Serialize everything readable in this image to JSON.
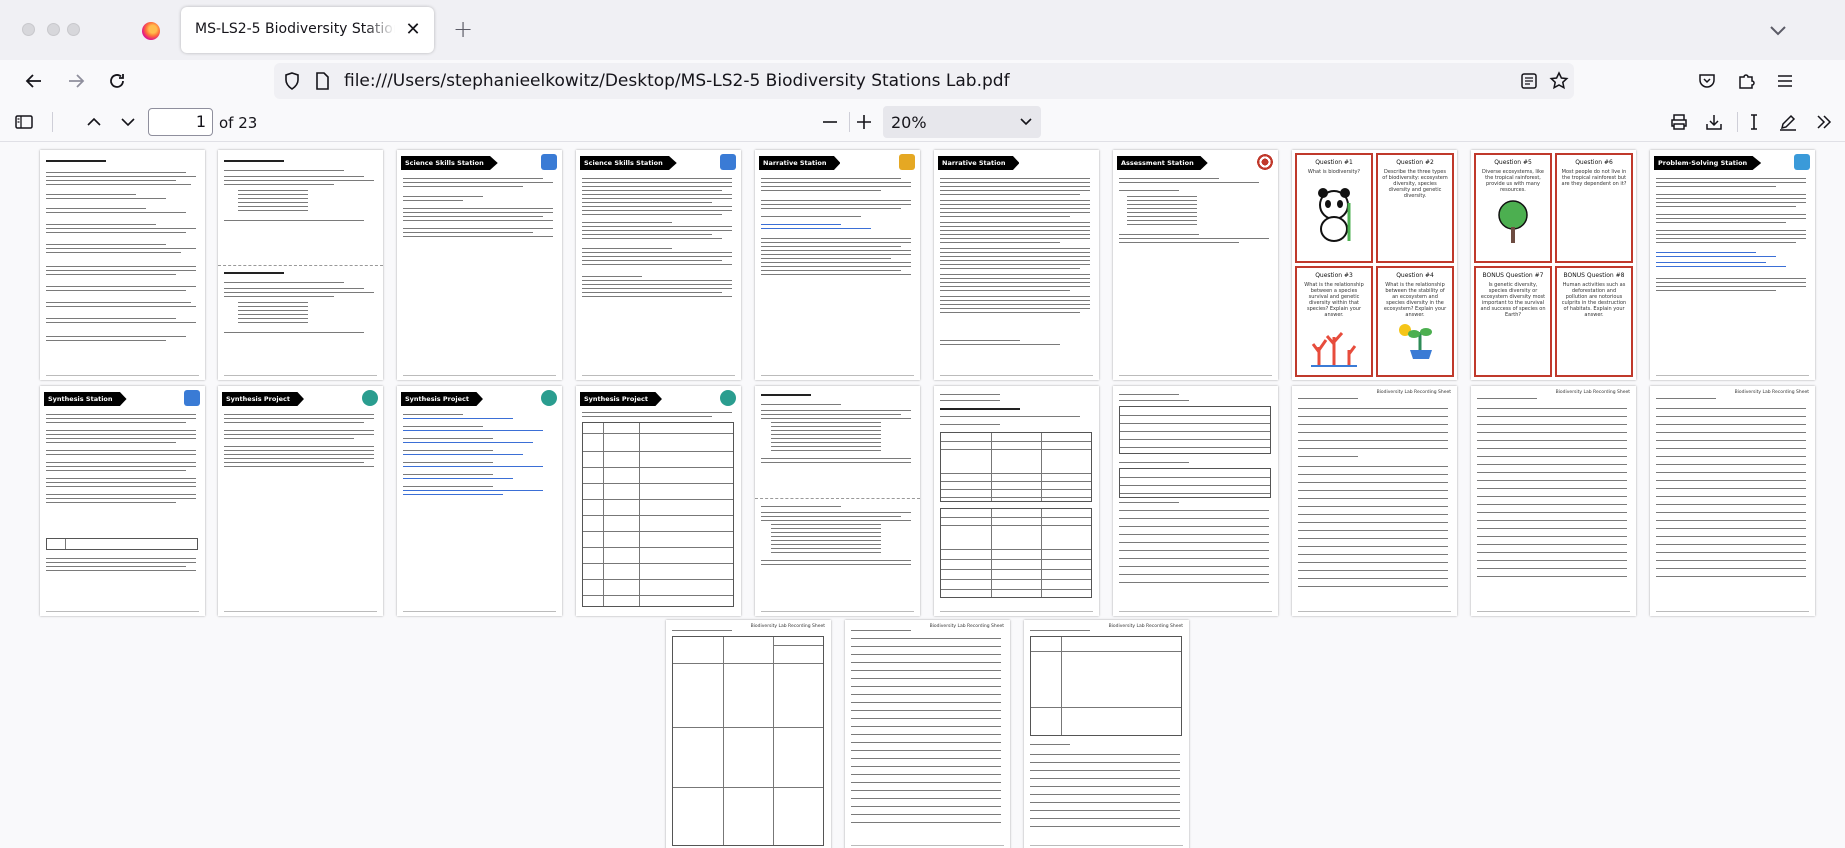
{
  "browser": {
    "tab_title": "MS-LS2-5 Biodiversity Stations Lab.pdf",
    "url": "file:///Users/stephanieelkowitz/Desktop/MS-LS2-5 Biodiversity Stations Lab.pdf"
  },
  "pdf_toolbar": {
    "page_number": "1",
    "page_total": "of 23",
    "zoom": "20%"
  },
  "thumbs": {
    "science_skills": "Science Skills Station",
    "narrative": "Narrative Station",
    "assessment": "Assessment Station",
    "problem_solving": "Problem-Solving Station",
    "synthesis_station": "Synthesis Station",
    "synthesis_project": "Synthesis Project",
    "recording_sheet": "Biodiversity Lab Recording Sheet"
  },
  "cards": [
    {
      "title": "Question #1",
      "body": "What is biodiversity?"
    },
    {
      "title": "Question #2",
      "body": "Describe the three types of biodiversity: ecosystem diversity, species diversity and genetic diversity."
    },
    {
      "title": "Question #5",
      "body": "Diverse ecosystems, like the tropical rainforest, provide us with many resources."
    },
    {
      "title": "Question #6",
      "body": "Most people do not live in the tropical rainforest but are they dependent on it?"
    },
    {
      "title": "Question #3",
      "body": "What is the relationship between a species survival and genetic diversity within that species? Explain your answer."
    },
    {
      "title": "Question #4",
      "body": "What is the relationship between the stability of an ecosystem and species diversity in the ecosystem? Explain your answer."
    },
    {
      "title": "BONUS Question #7",
      "body": "Is genetic diversity, species diversity or ecosystem diversity most important to the survival and success of species on Earth?"
    },
    {
      "title": "BONUS Question #8",
      "body": "Human activities such as deforestation and pollution are notorious culprits in the destruction of habitats. Explain your answer."
    }
  ]
}
